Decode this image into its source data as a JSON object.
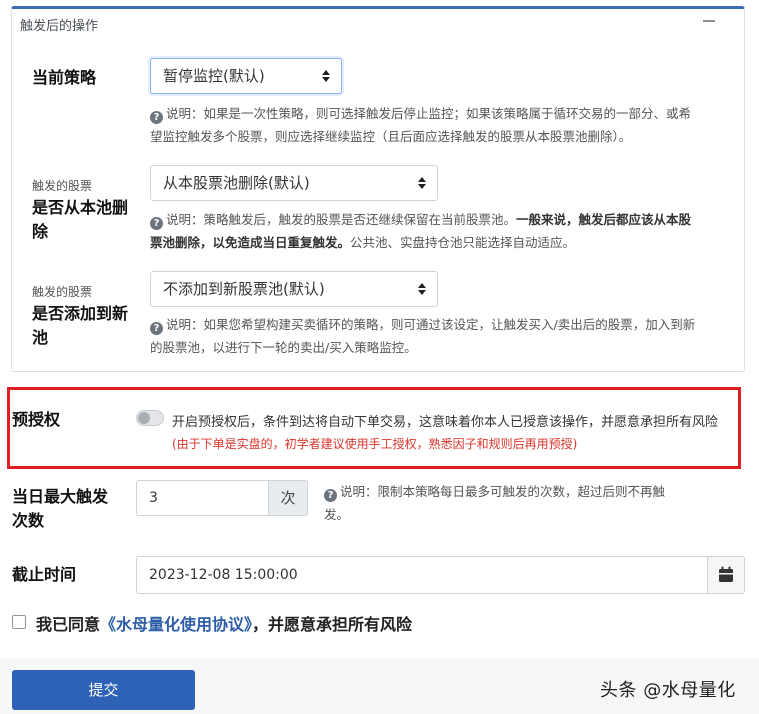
{
  "panel": {
    "title": "触发后的操作"
  },
  "strategy": {
    "label": "当前策略",
    "value": "暂停监控(默认)",
    "help_prefix": "说明：",
    "help_line1": "如果是一次性策略，则可选择触发后停止监控；如果该策略属于循环交易的一部分、或希",
    "help_line2": "望监控触发多个股票，则应选择继续监控（且后面应选择触发的股票从本股票池删除）。"
  },
  "remove_from_pool": {
    "small_label": "触发的股票",
    "label_line1": "是否从本池删",
    "label_line2": "除",
    "value": "从本股票池删除(默认)",
    "help_prefix": "说明：",
    "help_part1": "策略触发后，触发的股票是否还继续保留在当前股票池。",
    "help_bold1": "一般来说，触发后都应该从本股",
    "help_bold2": "票池删除，以免造成当日重复触发。",
    "help_part2": "公共池、实盘持仓池只能选择自动适应。"
  },
  "add_to_pool": {
    "small_label": "触发的股票",
    "label_line1": "是否添加到新",
    "label_line2": "池",
    "value": "不添加到新股票池(默认)",
    "help_prefix": "说明：",
    "help_line1": "如果您希望构建买卖循环的策略，则可通过该设定，让触发买入/卖出后的股票，加入到新",
    "help_line2": "的股票池，以进行下一轮的卖出/买入策略监控。"
  },
  "pre_auth": {
    "label": "预授权",
    "enabled": false,
    "text": "开启预授权后，条件到达将自动下单交易，这意味着你本人已授意该操作，并愿意承担所有风险",
    "warning": "(由于下单是实盘的，初学者建议使用手工授权，熟悉因子和规则后再用预授)"
  },
  "max_triggers": {
    "label_line1": "当日最大触发",
    "label_line2": "次数",
    "value": "3",
    "unit": "次",
    "help_prefix": "说明：",
    "help_line1": "限制本策略每日最多可触发的次数，超过后则不再触",
    "help_line2": "发。"
  },
  "deadline": {
    "label": "截止时间",
    "value": "2023-12-08 15:00:00",
    "icon": "calendar-icon"
  },
  "agreement": {
    "checked": false,
    "text_before": "我已同意",
    "link": "《水母量化使用协议》",
    "text_after": "，并愿意承担所有风险"
  },
  "submit_label": "提交",
  "watermark": "头条 @水母量化",
  "colors": {
    "primary": "#2e62b6",
    "panel_top_border": "#3b6cb7",
    "highlight_box": "#e02020",
    "warning_text": "#d9342b",
    "link": "#2d5da8"
  }
}
